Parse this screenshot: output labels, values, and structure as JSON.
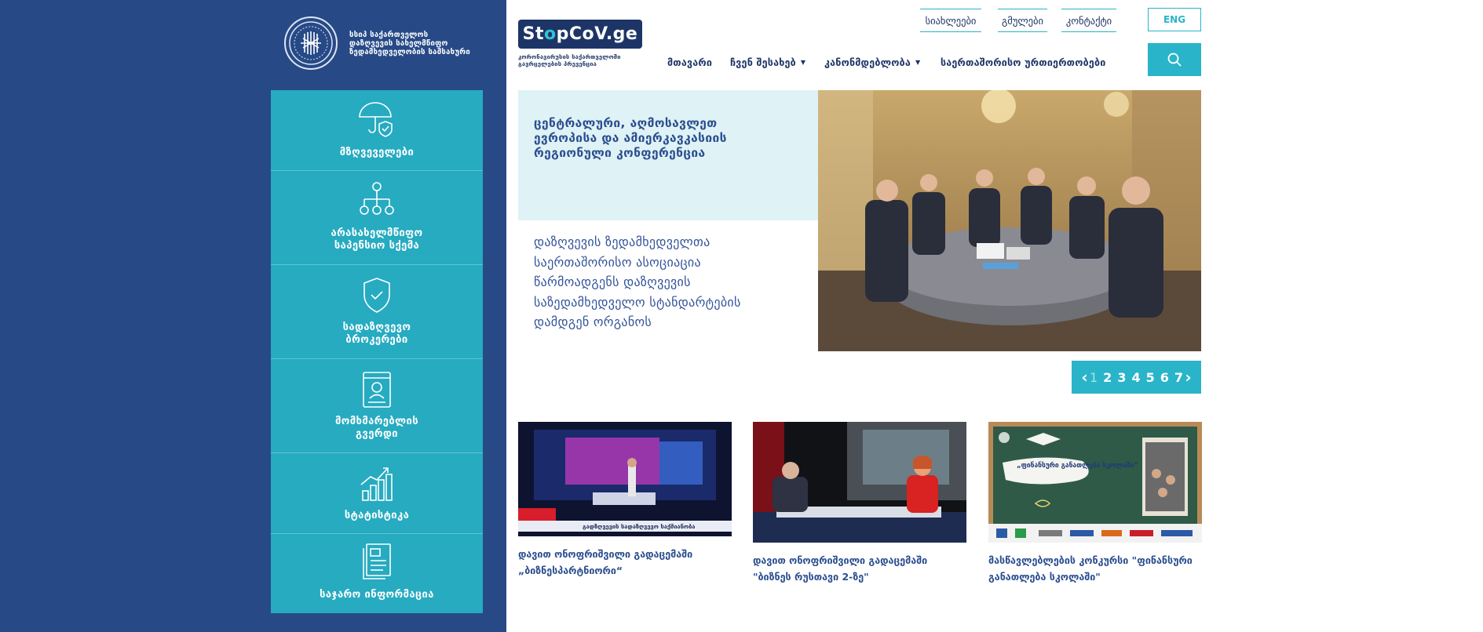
{
  "org": {
    "logo_line1": "სსიპ საქართველოს",
    "logo_line2": "დაზღვევის სახელმწიფო",
    "logo_line3": "ზედამხედველობის სამსახური"
  },
  "brand": {
    "name_a": "St",
    "name_o": "o",
    "name_b": "pCoV.ge",
    "sub_line1": "კორონავირუსის საქართველოში",
    "sub_line2": "გავრცელების პრევენცია"
  },
  "top_links": [
    "სიახლეები",
    "გმულები",
    "კონტაქტი"
  ],
  "lang": "ENG",
  "nav": [
    {
      "label": "მთავარი",
      "has_caret": false
    },
    {
      "label": "ჩვენ შესახებ",
      "has_caret": true
    },
    {
      "label": "კანონმდებლობა",
      "has_caret": true
    },
    {
      "label": "საერთაშორისო ურთიერთობები",
      "has_caret": false
    }
  ],
  "sidebar": [
    {
      "icon": "umbrella-shield-icon",
      "lines": [
        "მზღვეველები"
      ]
    },
    {
      "icon": "org-chart-icon",
      "lines": [
        "არასახელმწიფო",
        "საპენსიო სქემა"
      ]
    },
    {
      "icon": "shield-check-icon",
      "lines": [
        "სადაზღვევო",
        "ბროკერები"
      ]
    },
    {
      "icon": "user-card-icon",
      "lines": [
        "მომხმარებლის",
        "გვერდი"
      ]
    },
    {
      "icon": "chart-growth-icon",
      "lines": [
        "სტატისტიკა"
      ]
    },
    {
      "icon": "document-icon",
      "lines": [
        "საჯარო ინფორმაცია"
      ]
    }
  ],
  "hero": {
    "title_lines": [
      "ცენტრალური, აღმოსავლეთ",
      "ევროპისა და ამიერკავკასიის",
      "რეგიონული კონფერენცია"
    ],
    "desc_lines": [
      "დაზღვევის ზედამხედველთა",
      "საერთაშორისო ასოციაცია",
      "წარმოადგენს დაზღვევის",
      "საზედამხედველო სტანდარტების",
      "დამდგენ ორგანოს"
    ]
  },
  "pager": {
    "pages": [
      "1",
      "2",
      "3",
      "4",
      "5",
      "6",
      "7"
    ],
    "active_index": 0
  },
  "news": [
    {
      "title_lines": [
        "დავით ონოფრიშვილი გადაცემაში",
        "„ბიზნესპარტნიორი“"
      ],
      "thumb_caption": "გადზღვევის სადაზღვევო საქმიანობა"
    },
    {
      "title_lines": [
        "დავით ონოფრიშვილი გადაცემაში",
        "\"ბიზნეს რუსთავი 2-ზე\""
      ],
      "thumb_caption": ""
    },
    {
      "title_lines": [
        "მასწავლებლების კონკურსი \"ფინანსური",
        "განათლება სკოლაში\""
      ],
      "thumb_caption": "„ფინანსური განათლება სკოლაში“"
    }
  ],
  "colors": {
    "navy": "#274a87",
    "teal": "#26abc1",
    "title_blue": "#2a4d8f",
    "light_teal_bg": "#dff2f5"
  }
}
